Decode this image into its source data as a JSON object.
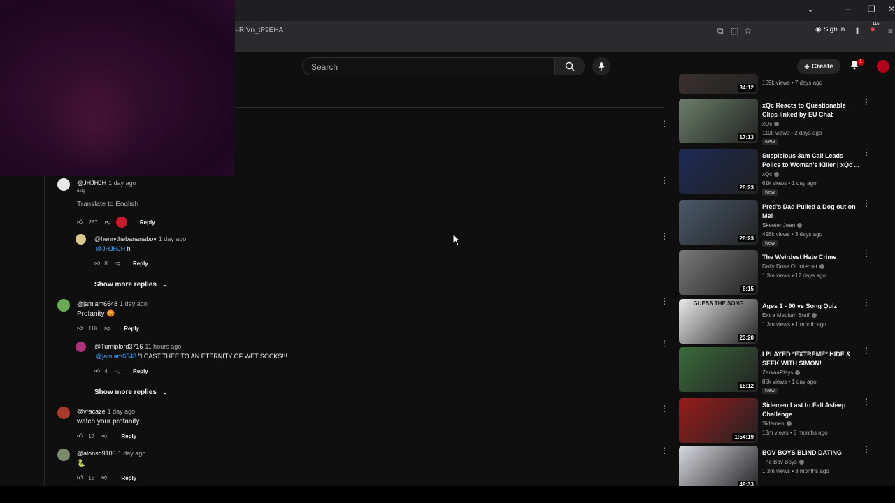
{
  "browser": {
    "url": "=RIVn_tP9EHA",
    "signin_label": "Sign in",
    "ext_badge": "115"
  },
  "header": {
    "search_placeholder": "Search",
    "create_label": "Create",
    "notif_count": "1"
  },
  "comments": [
    {
      "handle": "@JHJHJH",
      "time": "1 day ago",
      "subtext": "dafg",
      "text": "Translate to English",
      "likes": "287",
      "reply": "Reply"
    },
    {
      "handle": "@henrythebananaboy",
      "time": "1 day ago",
      "mention": "@JHJHJH",
      "text": " hi",
      "likes": "8",
      "reply": "Reply"
    },
    {
      "showmore": "Show more replies"
    },
    {
      "handle": "@jamlam6548",
      "time": "1 day ago",
      "text": "Profanity 😡",
      "likes": "118",
      "reply": "Reply"
    },
    {
      "handle": "@Turniplord3716",
      "time": "11 hours ago",
      "mention": "@jamlam6548",
      "text": " \"I CAST THEE TO AN ETERNITY OF WET SOCKS!!!",
      "likes": "4",
      "reply": "Reply"
    },
    {
      "showmore": "Show more replies"
    },
    {
      "handle": "@vracaze",
      "time": "1 day ago",
      "text": "watch your profanity",
      "likes": "17",
      "reply": "Reply"
    },
    {
      "handle": "@alonso9105",
      "time": "1 day ago",
      "text": "🐍",
      "likes": "16",
      "reply": "Reply"
    }
  ],
  "related": [
    {
      "title": "",
      "channel": "",
      "meta": "169k views • 7 days ago",
      "duration": "34:12",
      "new": ""
    },
    {
      "title": "xQc Reacts to Questionable Clips linked by EU Chat",
      "channel": "xQc",
      "meta": "110k views • 2 days ago",
      "duration": "17:13",
      "new": "New"
    },
    {
      "title": "Suspicious 3am Call Leads Police to Woman's Killer | xQc ...",
      "channel": "xQc",
      "meta": "61k views • 1 day ago",
      "duration": "28:23",
      "new": "New"
    },
    {
      "title": "Pred's Dad Pulled a Dog out on Me!",
      "channel": "Skeeter Jean",
      "meta": "498k views • 3 days ago",
      "duration": "28:23",
      "new": "New"
    },
    {
      "title": "The Weirdest Hate Crime",
      "channel": "Daily Dose Of Internet",
      "meta": "1.3m views • 12 days ago",
      "duration": "8:15",
      "new": ""
    },
    {
      "title": "Ages 1 - 90 vs Song Quiz",
      "channel": "Extra Medium Stuff",
      "meta": "1.3m views • 1 month ago",
      "duration": "23:20",
      "new": "",
      "thumbtext": "GUESS THE SONG"
    },
    {
      "title": "I PLAYED *EXTREME* HIDE & SEEK WITH SIMON!",
      "channel": "ZerkaaPlays",
      "meta": "85k views • 1 day ago",
      "duration": "18:12",
      "new": "New"
    },
    {
      "title": "Sidemen Last to Fall Asleep Challenge",
      "channel": "Sidemen",
      "meta": "13m views • 8 months ago",
      "duration": "1:54:19",
      "new": ""
    },
    {
      "title": "BOV BOYS BLIND DATING",
      "channel": "The Bov Boys",
      "meta": "1.3m views • 3 months ago",
      "duration": "49:33",
      "new": ""
    }
  ],
  "thumb_colors": [
    "#3a3030",
    "#6b7f6a",
    "#1c2a55",
    "#4a5a6a",
    "#7a7a7a",
    "#e8e8e8",
    "#3b6b3a",
    "#9a1c1c",
    "#d8d8e0"
  ]
}
